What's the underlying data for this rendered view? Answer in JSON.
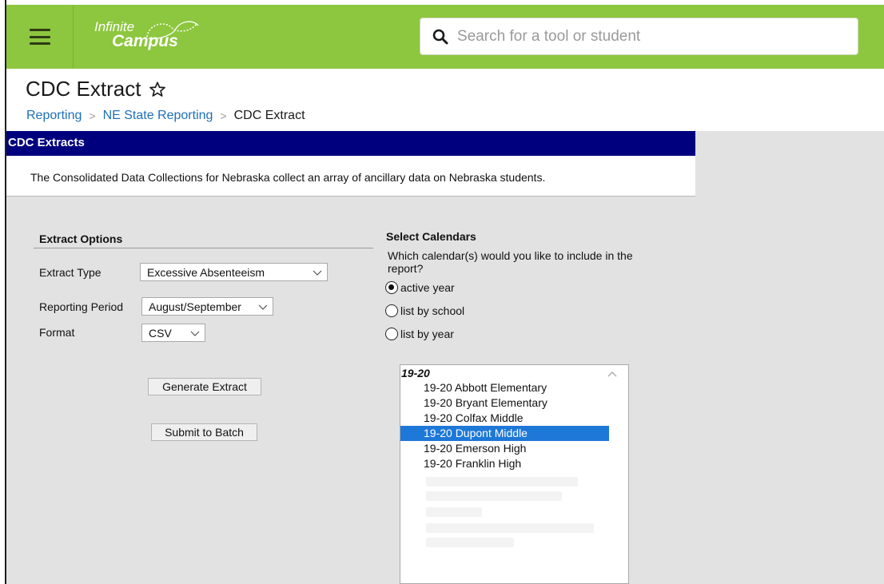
{
  "app": {
    "logo_line1": "Infinite",
    "logo_line2": "Campus"
  },
  "search": {
    "placeholder": "Search for a tool or student"
  },
  "page": {
    "title": "CDC Extract"
  },
  "breadcrumb": {
    "items": [
      "Reporting",
      "NE State Reporting"
    ],
    "current": "CDC Extract"
  },
  "banner": {
    "title": "CDC Extracts",
    "description": "The Consolidated Data Collections for Nebraska collect an array of ancillary data on Nebraska students."
  },
  "extract_options": {
    "heading": "Extract Options",
    "extract_type_label": "Extract Type",
    "extract_type_value": "Excessive Absenteeism",
    "reporting_period_label": "Reporting Period",
    "reporting_period_value": "August/September",
    "format_label": "Format",
    "format_value": "CSV",
    "generate_button": "Generate Extract",
    "batch_button": "Submit to Batch"
  },
  "calendars": {
    "heading": "Select Calendars",
    "question_line1": "Which calendar(s) would you like to include in the",
    "question_line2": "report?",
    "options": [
      "active year",
      "list by school",
      "list by year"
    ],
    "selected_option": "active year",
    "group": "19-20",
    "items": [
      "19-20 Abbott Elementary",
      "19-20 Bryant Elementary",
      "19-20 Colfax Middle",
      "19-20 Dupont Middle",
      "19-20 Emerson High",
      "19-20 Franklin High"
    ],
    "selected_item": "19-20 Dupont Middle"
  },
  "colors": {
    "topbar": "#8dc63f",
    "banner": "#00007f",
    "link": "#1d6fb8",
    "selection": "#1e78d7"
  },
  "icons": [
    "menu-icon",
    "infinite-campus-logo",
    "search-icon",
    "star-icon",
    "chevron-down-icon",
    "chevron-up-icon"
  ]
}
